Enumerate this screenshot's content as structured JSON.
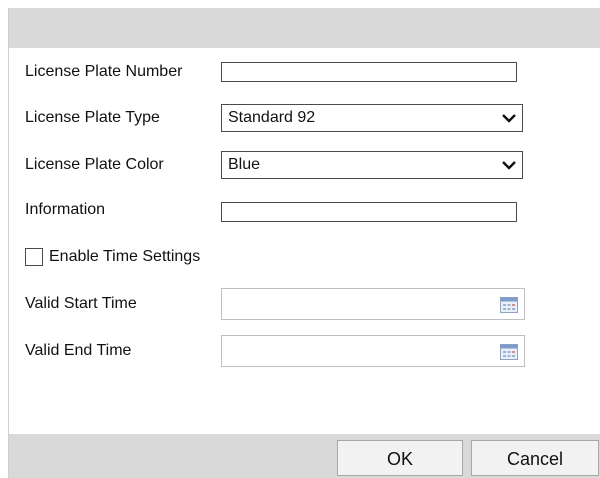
{
  "form": {
    "license_plate_number": {
      "label": "License Plate Number",
      "value": ""
    },
    "license_plate_type": {
      "label": "License Plate Type",
      "value": "Standard 92"
    },
    "license_plate_color": {
      "label": "License Plate Color",
      "value": "Blue"
    },
    "information": {
      "label": "Information",
      "value": ""
    },
    "enable_time_settings": {
      "label": "Enable Time Settings",
      "checked": false
    },
    "valid_start_time": {
      "label": "Valid Start Time",
      "value": ""
    },
    "valid_end_time": {
      "label": "Valid End Time",
      "value": ""
    }
  },
  "buttons": {
    "ok": "OK",
    "cancel": "Cancel"
  },
  "icons": {
    "select_arrow": "chevron-down-icon",
    "date_picker": "calendar-icon"
  },
  "colors": {
    "title_bar": "#d9d9d9",
    "footer": "#d9d9d9",
    "border": "#4a4a4a"
  }
}
